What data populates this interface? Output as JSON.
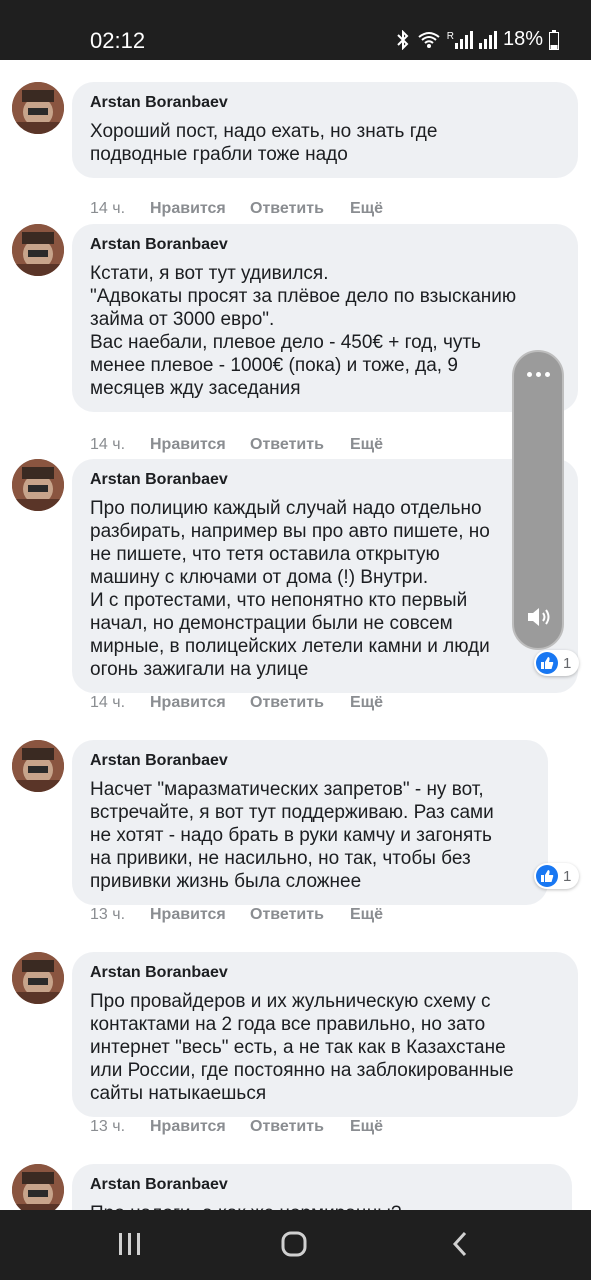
{
  "status_bar": {
    "time": "02:12",
    "battery": "18%",
    "signal_label": "R"
  },
  "comments": [
    {
      "author": "Arstan Boranbaev",
      "text": "Хороший пост, надо ехать, но знать где\nподводные грабли тоже надо",
      "time": "14 ч.",
      "like": "Нравится",
      "reply": "Ответить",
      "more": "Ещё",
      "reactions": null
    },
    {
      "author": "Arstan Boranbaev",
      "text": "Кстати, я вот тут удивился.\n\"Адвокаты просят за плёвое дело по взысканию\nзайма от 3000 евро\".\nВас наебали, плевое дело - 450€ + год, чуть\nменее плевое - 1000€ (пока) и тоже, да, 9\nмесяцев жду заседания",
      "time": "14 ч.",
      "like": "Нравится",
      "reply": "Ответить",
      "more": "Ещё",
      "reactions": null
    },
    {
      "author": "Arstan Boranbaev",
      "text": "Про полицию каждый случай надо отдельно\nразбирать, например вы про авто пишете, но\nне пишете, что тетя оставила открытую\nмашину с ключами от дома (!) Внутри.\nИ с протестами, что непонятно кто первый\nначал, но демонстрации были не совсем\nмирные, в полицейских летели камни и люди\nогонь зажигали на улице",
      "time": "14 ч.",
      "like": "Нравится",
      "reply": "Ответить",
      "more": "Ещё",
      "reactions": "1"
    },
    {
      "author": "Arstan Boranbaev",
      "text": "Насчет \"маразматических запретов\" - ну вот,\nвстречайте, я вот тут поддерживаю. Раз сами\nне хотят - надо брать в руки камчу и загонять\nна привики, не насильно, но так, чтобы без\nпрививки жизнь была сложнее",
      "time": "13 ч.",
      "like": "Нравится",
      "reply": "Ответить",
      "more": "Ещё",
      "reactions": "1"
    },
    {
      "author": "Arstan Boranbaev",
      "text": "Про провайдеров и их жульническую схему с\nконтактами на 2 года все правильно, но зато\nинтернет \"весь\" есть, а не так как в Казахстане\nили России, где постоянно на заблокированные\nсайты натыкаешься",
      "time": "13 ч.",
      "like": "Нравится",
      "reply": "Ответить",
      "more": "Ещё",
      "reactions": null
    },
    {
      "author": "Arstan Boranbaev",
      "text": "Про налоги- а как же нормирацны?",
      "time": "",
      "like": "",
      "reply": "",
      "more": "",
      "reactions": null
    }
  ],
  "volume_panel": {
    "icon": "speaker-icon",
    "menu_icon": "more-dots-icon"
  },
  "nav_bar": {
    "icons": [
      "recent-apps-icon",
      "home-icon",
      "back-icon"
    ]
  },
  "colors": {
    "bubble": "#eef0f3",
    "like_blue": "#1877f2",
    "bars": "#1f1f1f"
  }
}
